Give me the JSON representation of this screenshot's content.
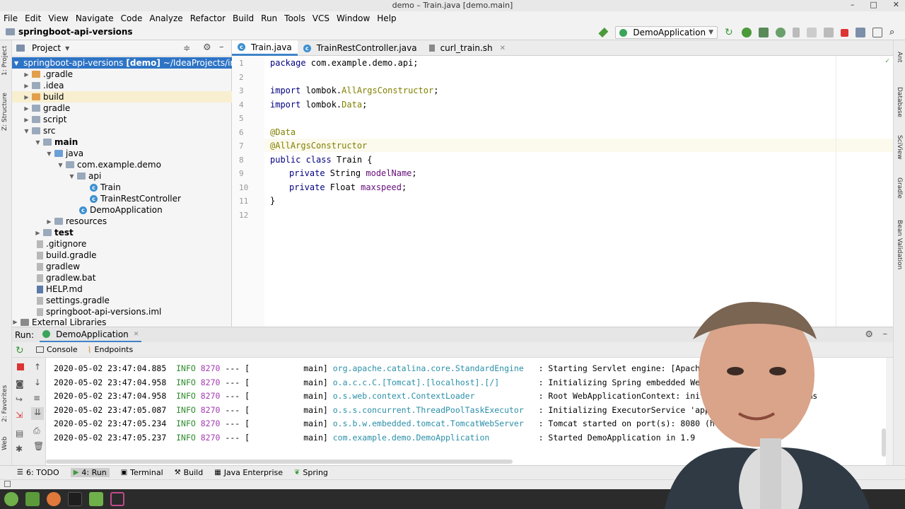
{
  "window": {
    "title": "demo – Train.java [demo.main]",
    "controls": [
      "–",
      "□",
      "✕"
    ]
  },
  "menu": [
    "File",
    "Edit",
    "View",
    "Navigate",
    "Code",
    "Analyze",
    "Refactor",
    "Build",
    "Run",
    "Tools",
    "VCS",
    "Window",
    "Help"
  ],
  "navbar": {
    "project_name": "springboot-api-versions",
    "run_config": "DemoApplication"
  },
  "left_strip": {
    "project": "1: Project",
    "structure": "Z: Structure",
    "favorites": "2: Favorites",
    "web": "Web"
  },
  "right_strip": {
    "ant": "Ant",
    "database": "Database",
    "sciview": "SciView",
    "gradle": "Gradle",
    "bean": "Bean Validation"
  },
  "project_panel": {
    "title": "Project",
    "root": {
      "name": "springboot-api-versions",
      "module": "[demo]",
      "path": "~/IdeaProjects/influencer/"
    },
    "items": [
      {
        "label": ".gradle"
      },
      {
        "label": ".idea"
      },
      {
        "label": "build"
      },
      {
        "label": "gradle"
      },
      {
        "label": "script"
      },
      {
        "label": "src"
      },
      {
        "label": "main"
      },
      {
        "label": "java"
      },
      {
        "label": "com.example.demo"
      },
      {
        "label": "api"
      },
      {
        "label": "Train"
      },
      {
        "label": "TrainRestController"
      },
      {
        "label": "DemoApplication"
      },
      {
        "label": "resources"
      },
      {
        "label": "test"
      },
      {
        "label": ".gitignore"
      },
      {
        "label": "build.gradle"
      },
      {
        "label": "gradlew"
      },
      {
        "label": "gradlew.bat"
      },
      {
        "label": "HELP.md"
      },
      {
        "label": "settings.gradle"
      },
      {
        "label": "springboot-api-versions.iml"
      },
      {
        "label": "External Libraries"
      }
    ]
  },
  "editor": {
    "tabs": [
      {
        "label": "Train.java"
      },
      {
        "label": "TrainRestController.java"
      },
      {
        "label": "curl_train.sh"
      }
    ],
    "line_numbers": [
      "1",
      "2",
      "3",
      "4",
      "5",
      "6",
      "7",
      "8",
      "9",
      "10",
      "11",
      "12"
    ],
    "lines": {
      "l1_kw": "package",
      "l1_rest": " com.example.demo.api;",
      "l3_kw": "import",
      "l3_pkg": " lombok.",
      "l3_cls": "AllArgsConstructor",
      "l3_end": ";",
      "l4_kw": "import",
      "l4_pkg": " lombok.",
      "l4_cls": "Data",
      "l4_end": ";",
      "l6_ann": "@Data",
      "l7_ann": "@AllArgsConstructor",
      "l8_kw": "public class",
      "l8_rest": " Train {",
      "l9_kw": "private",
      "l9_type": " String ",
      "l9_field": "modelName",
      "l9_end": ";",
      "l10_kw": "private",
      "l10_type": " Float ",
      "l10_field": "maxspeed",
      "l10_end": ";",
      "l11": "}"
    }
  },
  "run_panel": {
    "label": "Run:",
    "config_tab": "DemoApplication",
    "tabs": [
      "Console",
      "Endpoints"
    ],
    "log": [
      {
        "ts": "2020-05-02 23:47:04.885",
        "level": "INFO",
        "pid": "8270",
        "sep": "---",
        "thread": "[           main]",
        "logger": "org.apache.catalina.core.StandardEngine  ",
        "msg": ": Starting Servlet engine: [Apache Tomc"
      },
      {
        "ts": "2020-05-02 23:47:04.958",
        "level": "INFO",
        "pid": "8270",
        "sep": "---",
        "thread": "[           main]",
        "logger": "o.a.c.c.C.[Tomcat].[localhost].[/]       ",
        "msg": ": Initializing Spring embedded WebApplica"
      },
      {
        "ts": "2020-05-02 23:47:04.958",
        "level": "INFO",
        "pid": "8270",
        "sep": "---",
        "thread": "[           main]",
        "logger": "o.s.web.context.ContextLoader            ",
        "msg": ": Root WebApplicationContext: initializa           865 ms"
      },
      {
        "ts": "2020-05-02 23:47:05.087",
        "level": "INFO",
        "pid": "8270",
        "sep": "---",
        "thread": "[           main]",
        "logger": "o.s.s.concurrent.ThreadPoolTaskExecutor  ",
        "msg": ": Initializing ExecutorService 'applicati"
      },
      {
        "ts": "2020-05-02 23:47:05.234",
        "level": "INFO",
        "pid": "8270",
        "sep": "---",
        "thread": "[           main]",
        "logger": "o.s.b.w.embedded.tomcat.TomcatWebServer  ",
        "msg": ": Tomcat started on port(s): 8080 (http) w"
      },
      {
        "ts": "2020-05-02 23:47:05.237",
        "level": "INFO",
        "pid": "8270",
        "sep": "---",
        "thread": "[           main]",
        "logger": "com.example.demo.DemoApplication         ",
        "msg": ": Started DemoApplication in 1.9"
      }
    ]
  },
  "bottom_tools": [
    "6: TODO",
    "4: Run",
    "Terminal",
    "Build",
    "Java Enterprise",
    "Spring"
  ],
  "colors": {
    "accent": "#2e74c5",
    "tab_underline": "#4083c9",
    "info": "#2e8b2e",
    "pid": "#a23bb0",
    "logger": "#2a8fa8",
    "annotation": "#808000",
    "keyword": "#000080",
    "field": "#660e7a"
  }
}
